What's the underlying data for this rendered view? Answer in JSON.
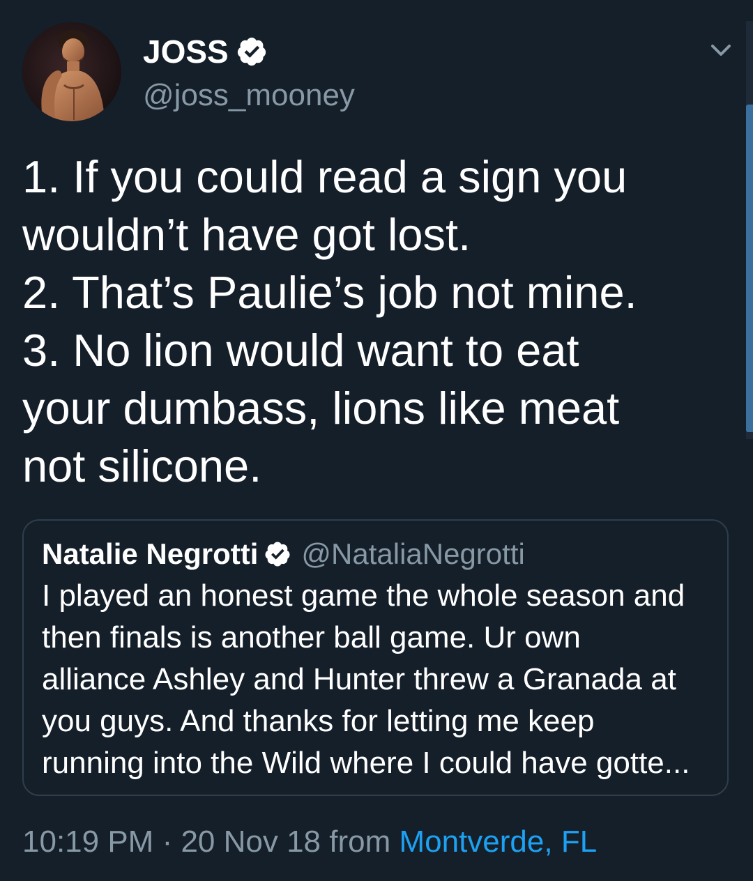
{
  "tweet": {
    "author": {
      "name": "JOSS",
      "handle": "@joss_mooney",
      "verified_icon": "verified-badge-icon"
    },
    "menu_icon": "chevron-down-icon",
    "text_lines": [
      "1. If you could read a sign you",
      "wouldn’t have got lost.",
      "2. That’s Paulie’s job not mine.",
      "3. No lion would want to eat",
      "your dumbass, lions like meat",
      "not silicone."
    ],
    "quoted_tweet": {
      "author_name": "Natalie Negrotti",
      "author_handle": "@NataliaNegrotti",
      "verified_icon": "verified-badge-icon",
      "text_lines": [
        "I played an honest game the whole season and",
        "then finals is another ball game. Ur own",
        "alliance Ashley and Hunter threw a Granada at",
        "you guys.  And thanks for letting me keep",
        "running into the Wild where I could have gotte..."
      ]
    },
    "meta": {
      "time": "10:19 PM",
      "separator": " · ",
      "date": "20 Nov 18",
      "from_label": " from ",
      "location": "Montverde, FL"
    }
  },
  "colors": {
    "background": "#151f2a",
    "secondary_text": "#8899a6",
    "link": "#1da1f2",
    "border": "#2f3d4c",
    "scrollbar_thumb": "#3b6f9e"
  }
}
